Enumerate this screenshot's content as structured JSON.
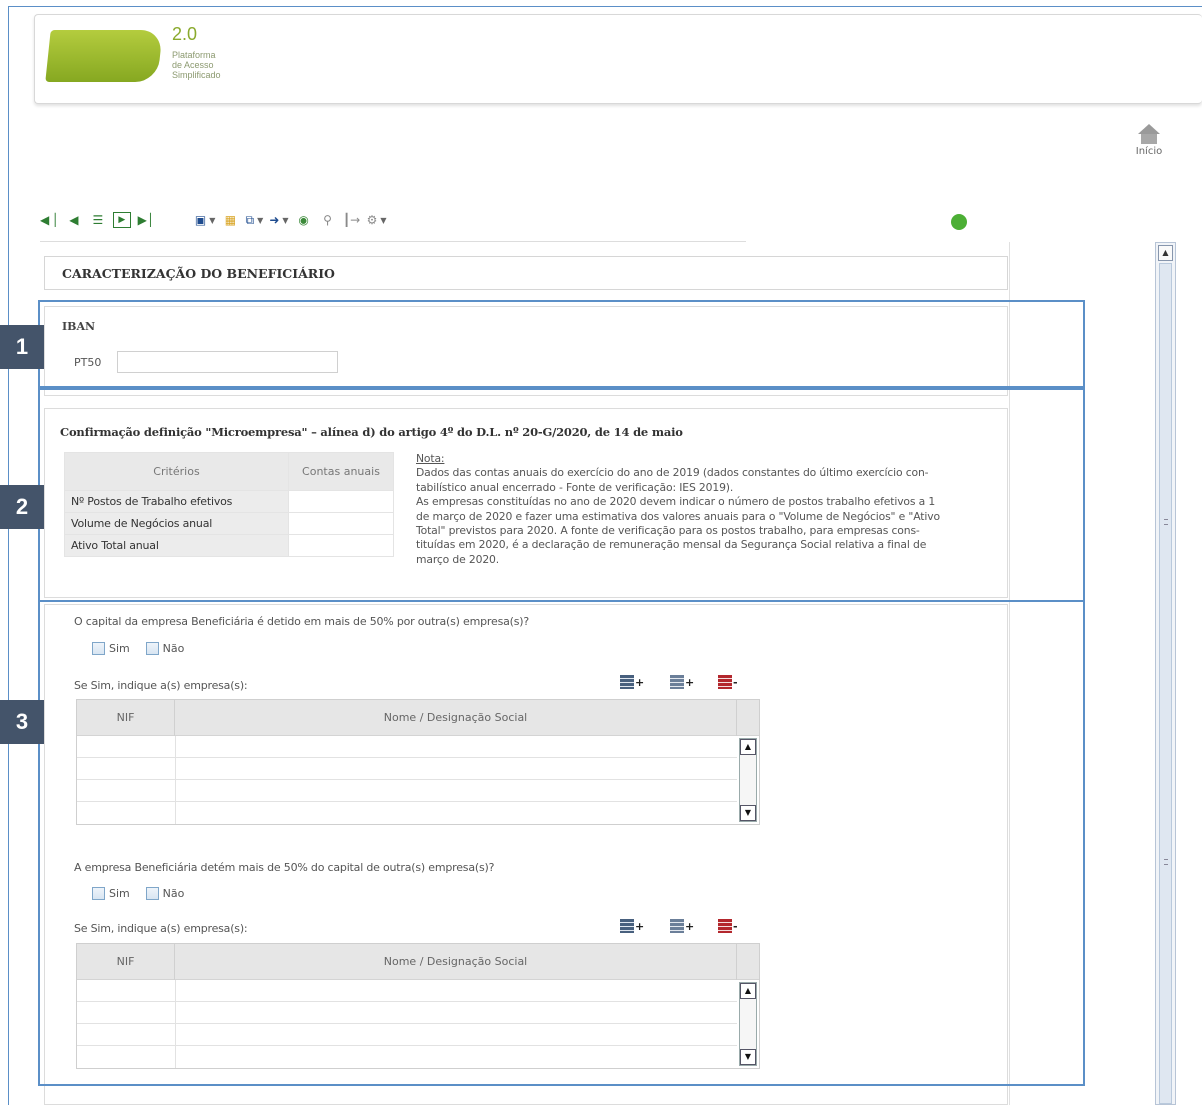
{
  "logo": {
    "version": "2.0",
    "subtitle_1": "Plataforma",
    "subtitle_2": "de Acesso",
    "subtitle_3": "Simplificado",
    "mark": "PAS",
    "brand_color": "#8aaa2d"
  },
  "header": {
    "home_label": "Início",
    "home_icon": "home-icon"
  },
  "toolbar": {
    "icons": [
      "first-record-icon",
      "previous-record-icon",
      "list-icon",
      "next-record-icon",
      "last-record-icon",
      "save-icon",
      "open-folder-icon",
      "copy-icon",
      "export-icon",
      "globe-icon",
      "search-icon",
      "exit-icon",
      "settings-icon"
    ],
    "status_color": "#4caf35"
  },
  "section": {
    "title": "CARACTERIZAÇÃO DO BENEFICIÁRIO"
  },
  "badges": {
    "b1": "1",
    "b2": "2",
    "b3": "3"
  },
  "iban": {
    "title": "IBAN",
    "prefix": "PT50",
    "value": ""
  },
  "micro": {
    "title": "Confirmação definição \"Microempresa\" – alínea d) do artigo 4º do D.L. nº 20-G/2020, de 14 de maio",
    "col_criteria": "Critérios",
    "col_accounts": "Contas anuais",
    "rows": [
      "Nº Postos de Trabalho efetivos",
      "Volume de Negócios anual",
      "Ativo Total anual"
    ],
    "note_label": "Nota:",
    "note_lines": [
      "Dados das contas anuais do exercício do ano de 2019 (dados constantes do último exercício con-",
      "tabilístico anual encerrado - Fonte de verificação: IES 2019).",
      "As empresas constituídas no ano de 2020 devem indicar o número de postos trabalho efetivos a 1",
      "de março de 2020 e fazer uma estimativa dos valores anuais para o \"Volume de Negócios\" e \"Ativo",
      "Total\" previstos para 2020. A fonte de verificação para os postos trabalho, para empresas cons-",
      "tituídas em 2020, é a declaração de remuneração mensal da Segurança Social relativa a final de",
      "março de 2020."
    ]
  },
  "q1": {
    "question": "O capital da empresa Beneficiária é detido em mais de 50% por outra(s) empresa(s)?",
    "yes": "Sim",
    "no": "Não",
    "indicate": "Se Sim, indique a(s) empresa(s):",
    "col_nif": "NIF",
    "col_name": "Nome / Designação Social"
  },
  "q2": {
    "question": "A empresa Beneficiária detém mais de 50% do capital de outra(s) empresa(s)?",
    "yes": "Sim",
    "no": "Não",
    "indicate": "Se Sim, indique a(s) empresa(s):",
    "col_nif": "NIF",
    "col_name": "Nome / Designação Social"
  }
}
